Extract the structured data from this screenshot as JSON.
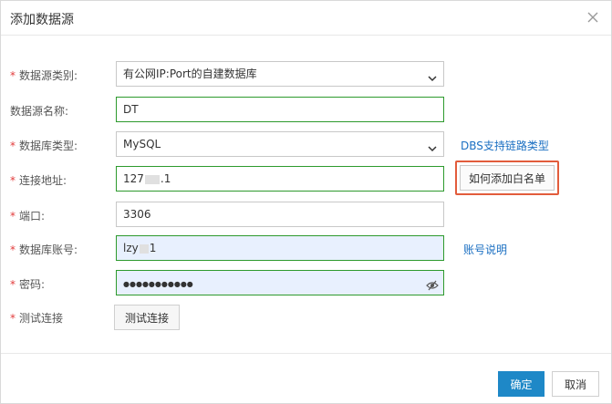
{
  "dialog": {
    "title": "添加数据源",
    "close_icon": "close-icon"
  },
  "form": {
    "datasource_type": {
      "label": "数据源类别:",
      "required": true,
      "value": "有公网IP:Port的自建数据库"
    },
    "datasource_name": {
      "label": "数据源名称:",
      "required": false,
      "value": "DT"
    },
    "db_type": {
      "label": "数据库类型:",
      "required": true,
      "value": "MySQL",
      "link": "DBS支持链路类型"
    },
    "address": {
      "label": "连接地址:",
      "required": true,
      "value_prefix": "127",
      "value_suffix": ".1",
      "whitelist_button": "如何添加白名单"
    },
    "port": {
      "label": "端口:",
      "required": true,
      "value": "3306"
    },
    "account": {
      "label": "数据库账号:",
      "required": true,
      "value_prefix": "lzy",
      "value_suffix": "1",
      "link": "账号说明"
    },
    "password": {
      "label": "密码:",
      "required": true,
      "value": "●●●●●●●●●●●",
      "eye_icon": "eye-slash-icon"
    },
    "test": {
      "label": "测试连接",
      "required": true,
      "button": "测试连接"
    }
  },
  "footer": {
    "confirm": "确定",
    "cancel": "取消"
  },
  "colors": {
    "primary": "#1e88c7",
    "required": "#e23c3c",
    "valid_border": "#2d9a2d",
    "highlight": "#e25c3c",
    "link": "#1a6fc2"
  }
}
